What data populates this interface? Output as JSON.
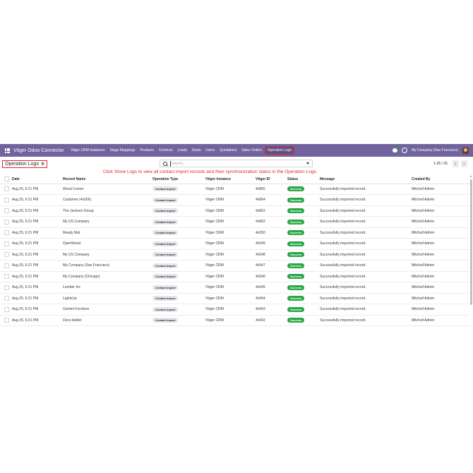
{
  "navbar": {
    "brand": "Vtiger Odoo Connector",
    "menu": [
      "Vtiger CRM Instances",
      "Stage Mappings",
      "Products",
      "Contacts",
      "Leads",
      "Deals",
      "Users",
      "Quotations",
      "Sales Orders",
      "Operation Logs"
    ],
    "active": "Operation Logs",
    "company": "My Company (San Francisco)"
  },
  "breadcrumb": {
    "title": "Operation Logs"
  },
  "search": {
    "placeholder": "Search..."
  },
  "annotation": "Click Show Logs to view all contact import records and their synchronization status in the Operation Logs.",
  "pager": {
    "value": "1-25 / 25"
  },
  "table": {
    "headers": [
      "Date",
      "Record Name",
      "Operation Type",
      "Vtiger Instance",
      "Vtiger ID",
      "Status",
      "Message",
      "Created By"
    ],
    "rows": [
      [
        "Aug 25, 6:21 PM",
        "Wood Corner",
        "Contact Import",
        "Vtiger CRM",
        "4x865",
        "Success",
        "Successfully imported record.",
        "Mitchell Admin"
      ],
      [
        "Aug 25, 6:21 PM",
        "Customer (4x506)",
        "Contact Import",
        "Vtiger CRM",
        "4x864",
        "Success",
        "Successfully imported record.",
        "Mitchell Admin"
      ],
      [
        "Aug 25, 6:21 PM",
        "The Jackson Group",
        "Contact Import",
        "Vtiger CRM",
        "4x863",
        "Success",
        "Successfully imported record.",
        "Mitchell Admin"
      ],
      [
        "Aug 25, 6:21 PM",
        "My US Company",
        "Contact Import",
        "Vtiger CRM",
        "4x862",
        "Success",
        "Successfully imported record.",
        "Mitchell Admin"
      ],
      [
        "Aug 25, 6:21 PM",
        "Ready Mat",
        "Contact Import",
        "Vtiger CRM",
        "4x550",
        "Success",
        "Successfully imported record.",
        "Mitchell Admin"
      ],
      [
        "Aug 25, 6:21 PM",
        "OpenWood",
        "Contact Import",
        "Vtiger CRM",
        "4x549",
        "Success",
        "Successfully imported record.",
        "Mitchell Admin"
      ],
      [
        "Aug 25, 6:21 PM",
        "My US Company",
        "Contact Import",
        "Vtiger CRM",
        "4x548",
        "Success",
        "Successfully imported record.",
        "Mitchell Admin"
      ],
      [
        "Aug 25, 6:21 PM",
        "My Company (San Francisco)",
        "Contact Import",
        "Vtiger CRM",
        "4x547",
        "Success",
        "Successfully imported record.",
        "Mitchell Admin"
      ],
      [
        "Aug 25, 6:21 PM",
        "My Company (Chicago)",
        "Contact Import",
        "Vtiger CRM",
        "4x546",
        "Success",
        "Successfully imported record.",
        "Mitchell Admin"
      ],
      [
        "Aug 25, 6:21 PM",
        "Lumber Inc",
        "Contact Import",
        "Vtiger CRM",
        "4x545",
        "Success",
        "Successfully imported record.",
        "Mitchell Admin"
      ],
      [
        "Aug 25, 6:21 PM",
        "LightsUp",
        "Contact Import",
        "Vtiger CRM",
        "4x544",
        "Success",
        "Successfully imported record.",
        "Mitchell Admin"
      ],
      [
        "Aug 25, 6:21 PM",
        "Gemini Furniture",
        "Contact Import",
        "Vtiger CRM",
        "4x543",
        "Success",
        "Successfully imported record.",
        "Mitchell Admin"
      ],
      [
        "Aug 25, 6:21 PM",
        "Deco Addict",
        "Contact Import",
        "Vtiger CRM",
        "4x542",
        "Success",
        "Successfully imported record.",
        "Mitchell Admin"
      ]
    ]
  },
  "colors": {
    "navbar": "#71639e",
    "highlight": "#e0252b",
    "success": "#28a745"
  }
}
